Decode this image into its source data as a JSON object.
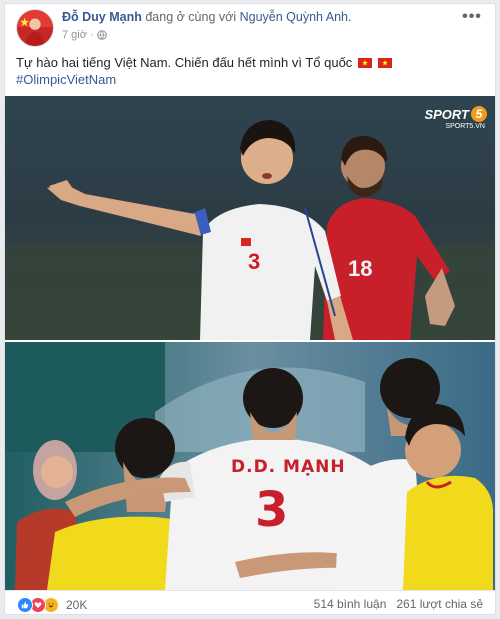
{
  "post": {
    "author": "Đỗ Duy Mạnh",
    "with_text": "đang ở cùng với",
    "tagged": "Nguyễn Quỳnh Anh.",
    "time": "7 giờ ·",
    "more_label": "•••",
    "text": "Tự hào hai tiếng Việt Nam. Chiến đấu hết mình vì Tổ quốc",
    "hashtag": "#OlimpicVietNam"
  },
  "photo1": {
    "watermark": "SPORT",
    "watermark_num": "5",
    "watermark_sub": "SPORT5.VN",
    "shirt_number_1": "3",
    "shirt_number_2": "18"
  },
  "photo2": {
    "jersey_name": "D.D. MẠNH",
    "jersey_number": "3"
  },
  "footer": {
    "reaction_count": "20K",
    "comments": "514 bình luận",
    "shares": "261 lượt chia sẻ"
  },
  "colors": {
    "link": "#385898",
    "like": "#2d88ff",
    "love": "#f33e58",
    "haha": "#f7b125",
    "vietnam_red": "#da251d",
    "vietnam_star": "#ffff00"
  },
  "icons": [
    "globe-icon",
    "flag-vietnam-icon",
    "like-icon",
    "love-icon",
    "haha-icon",
    "more-icon"
  ]
}
